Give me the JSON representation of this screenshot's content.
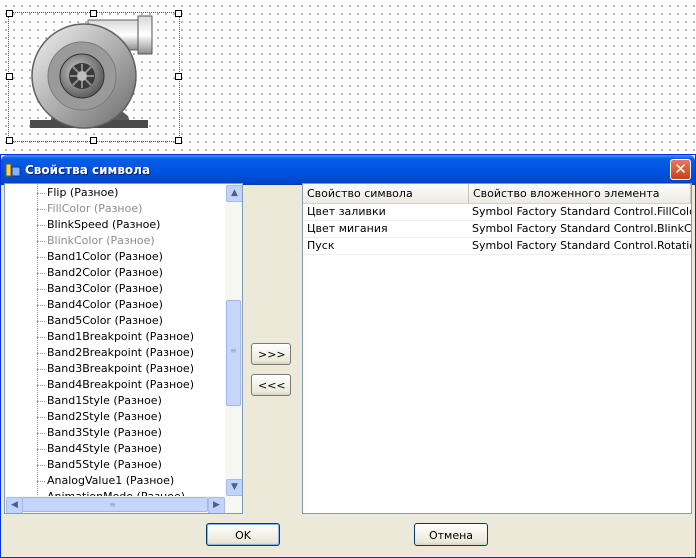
{
  "dialog": {
    "title": "Свойства символа",
    "close_label": "✕"
  },
  "left_list": {
    "items": [
      {
        "label": "Flip (Разное)",
        "disabled": false
      },
      {
        "label": "FillColor (Разное)",
        "disabled": true
      },
      {
        "label": "BlinkSpeed (Разное)",
        "disabled": false
      },
      {
        "label": "BlinkColor (Разное)",
        "disabled": true
      },
      {
        "label": "Band1Color (Разное)",
        "disabled": false
      },
      {
        "label": "Band2Color (Разное)",
        "disabled": false
      },
      {
        "label": "Band3Color (Разное)",
        "disabled": false
      },
      {
        "label": "Band4Color (Разное)",
        "disabled": false
      },
      {
        "label": "Band5Color (Разное)",
        "disabled": false
      },
      {
        "label": "Band1Breakpoint (Разное)",
        "disabled": false
      },
      {
        "label": "Band2Breakpoint (Разное)",
        "disabled": false
      },
      {
        "label": "Band3Breakpoint (Разное)",
        "disabled": false
      },
      {
        "label": "Band4Breakpoint (Разное)",
        "disabled": false
      },
      {
        "label": "Band1Style (Разное)",
        "disabled": false
      },
      {
        "label": "Band2Style (Разное)",
        "disabled": false
      },
      {
        "label": "Band3Style (Разное)",
        "disabled": false
      },
      {
        "label": "Band4Style (Разное)",
        "disabled": false
      },
      {
        "label": "Band5Style (Разное)",
        "disabled": false
      },
      {
        "label": "AnalogValue1 (Разное)",
        "disabled": false
      },
      {
        "label": "AnimationMode (Разное)",
        "disabled": false
      }
    ]
  },
  "buttons": {
    "add": ">>>",
    "remove": "<<<",
    "ok": "OK",
    "cancel": "Отмена"
  },
  "grid": {
    "headers": [
      "Свойство символа",
      "Свойство вложенного элемента"
    ],
    "rows": [
      [
        "Цвет заливки",
        "Symbol Factory Standard Control.FillColor"
      ],
      [
        "Цвет мигания",
        "Symbol Factory Standard Control.BlinkColor"
      ],
      [
        "Пуск",
        "Symbol Factory Standard Control.Rotation"
      ]
    ]
  },
  "icons": {
    "scroll_up": "▲",
    "scroll_down": "▼",
    "scroll_left": "◀",
    "scroll_right": "▶",
    "grip": "≡"
  }
}
